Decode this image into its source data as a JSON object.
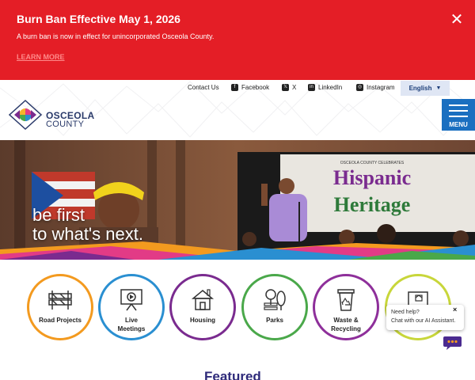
{
  "alert": {
    "title": "Burn Ban Effective May 1, 2026",
    "text": "A burn ban is now in effect for unincorporated Osceola County.",
    "link": "LEARN MORE",
    "close_glyph": "✕",
    "bg_color": "#e41e26"
  },
  "header": {
    "utility_links": {
      "contact": "Contact Us",
      "facebook": "Facebook",
      "x": "X",
      "linkedin": "LinkedIn",
      "instagram": "Instagram"
    },
    "language": "English",
    "logo_line1": "OSCEOLA",
    "logo_line2": "COUNTY",
    "menu_label": "MENU",
    "menu_color": "#1a6fc0"
  },
  "hero": {
    "line1": "be first",
    "line2": "to what's next.",
    "banner_text1": "Hispanic",
    "banner_text2": "Heritage",
    "banner_small": "OSCEOLA COUNTY CELEBRATES"
  },
  "quick_links": [
    {
      "label": "Road Projects",
      "icon": "road-barrier-icon",
      "color": "#f39a1f"
    },
    {
      "label": "Live Meetings",
      "icon": "presentation-board-icon",
      "color": "#2a8fd1"
    },
    {
      "label": "Housing",
      "icon": "house-icon",
      "color": "#7a2b8f"
    },
    {
      "label": "Parks",
      "icon": "tree-bench-icon",
      "color": "#4aa84a"
    },
    {
      "label": "Waste & Recycling",
      "icon": "recycling-bin-icon",
      "color": "#8e2f9a"
    },
    {
      "label": "",
      "icon": "building-icon",
      "color": "#c8d63a"
    }
  ],
  "featured_heading": "Featured",
  "chat": {
    "line1": "Need help?",
    "line2": "Chat with our AI Assistant.",
    "close": "×"
  }
}
